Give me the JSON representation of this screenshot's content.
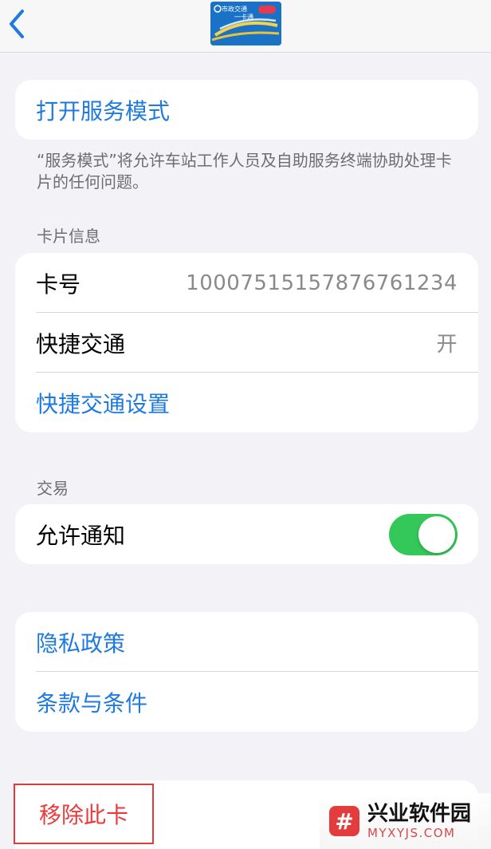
{
  "navbar": {
    "back_icon": "chevron-left-icon",
    "card_logo_line1": "市政交通",
    "card_logo_line2": "一卡通"
  },
  "service": {
    "open_label": "打开服务模式",
    "footnote": "“服务模式”将允许车站工作人员及自助服务终端协助处理卡片的任何问题。"
  },
  "card_info": {
    "header": "卡片信息",
    "card_number_label": "卡号",
    "card_number_value": "10007515157876761234",
    "express_label": "快捷交通",
    "express_value": "开",
    "express_settings_label": "快捷交通设置"
  },
  "transactions": {
    "header": "交易",
    "allow_notifications_label": "允许通知",
    "allow_notifications_on": true
  },
  "legal": {
    "privacy_label": "隐私政策",
    "terms_label": "条款与条件"
  },
  "remove": {
    "label": "移除此卡"
  },
  "watermark": {
    "title": "兴业软件园",
    "url": "MYXYJS.COM",
    "logo_glyph": "#"
  },
  "colors": {
    "accent": "#1f7ae0",
    "toggle_on": "#34c759",
    "destructive": "#ea3a3a",
    "background": "#f2f2f7"
  }
}
